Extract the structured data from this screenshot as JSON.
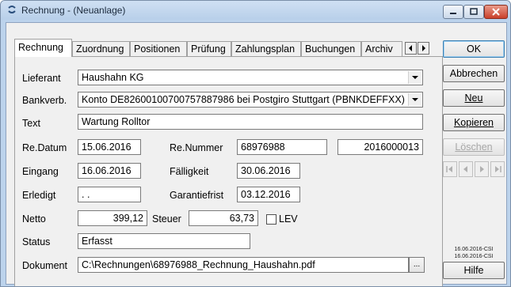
{
  "window": {
    "title": "Rechnung - (Neuanlage)"
  },
  "tabs": [
    "Rechnung",
    "Zuordnung",
    "Positionen",
    "Prüfung",
    "Zahlungsplan",
    "Buchungen",
    "Archiv"
  ],
  "form": {
    "lieferant": {
      "label": "Lieferant",
      "value": "Haushahn KG"
    },
    "bankverb": {
      "label": "Bankverb.",
      "value": "Konto DE82600100700757887986 bei Postgiro Stuttgart (PBNKDEFFXX)"
    },
    "text": {
      "label": "Text",
      "value": "Wartung Rolltor"
    },
    "re_datum": {
      "label": "Re.Datum",
      "value": "15.06.2016"
    },
    "re_nummer": {
      "label": "Re.Nummer",
      "value": "68976988",
      "value2": "2016000013"
    },
    "eingang": {
      "label": "Eingang",
      "value": "16.06.2016"
    },
    "faelligkeit": {
      "label": "Fälligkeit",
      "value": "30.06.2016"
    },
    "erledigt": {
      "label": "Erledigt",
      "value": " .  ."
    },
    "garantiefrist": {
      "label": "Garantiefrist",
      "value": "03.12.2016"
    },
    "netto": {
      "label": "Netto",
      "value": "399,12"
    },
    "steuer": {
      "label": "Steuer",
      "value": "63,73"
    },
    "lev": {
      "label": "LEV",
      "checked": false
    },
    "status": {
      "label": "Status",
      "value": "Erfasst"
    },
    "dokument": {
      "label": "Dokument",
      "value": "C:\\Rechnungen\\68976988_Rechnung_Haushahn.pdf",
      "browse": "..."
    }
  },
  "buttons": {
    "ok": "OK",
    "abbrechen": "Abbrechen",
    "neu": "Neu",
    "kopieren": "Kopieren",
    "loeschen": "Löschen",
    "hilfe": "Hilfe"
  },
  "version": [
    "16.06.2016-CSI",
    "16.06.2016-CSI"
  ],
  "colors": {
    "title_bar": "#bcd3ec",
    "client": "#f0f0f0",
    "close_button": "#c9402a"
  }
}
